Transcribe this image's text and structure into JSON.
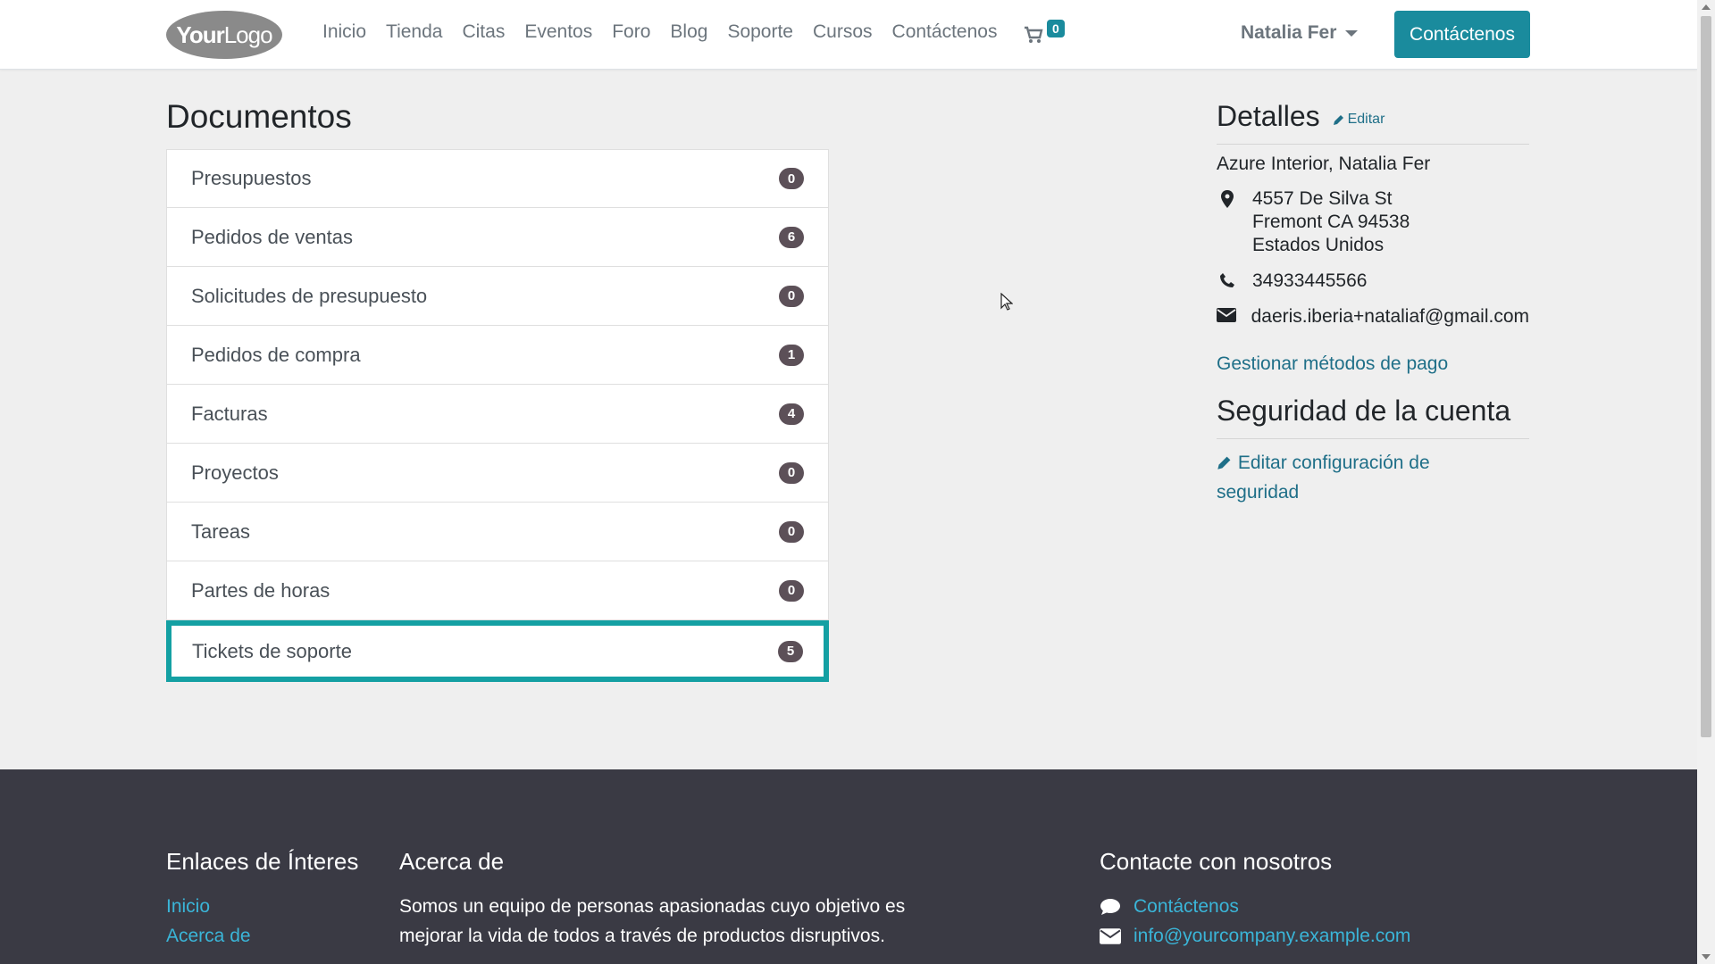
{
  "header": {
    "logo_bold": "Your",
    "logo_light": "Logo",
    "nav": [
      "Inicio",
      "Tienda",
      "Citas",
      "Eventos",
      "Foro",
      "Blog",
      "Soporte",
      "Cursos",
      "Contáctenos"
    ],
    "cart_count": "0",
    "user_name": "Natalia Fer",
    "contact_button": "Contáctenos"
  },
  "documents": {
    "title": "Documentos",
    "items": [
      {
        "label": "Presupuestos",
        "count": "0"
      },
      {
        "label": "Pedidos de ventas",
        "count": "6"
      },
      {
        "label": "Solicitudes de presupuesto",
        "count": "0"
      },
      {
        "label": "Pedidos de compra",
        "count": "1"
      },
      {
        "label": "Facturas",
        "count": "4"
      },
      {
        "label": "Proyectos",
        "count": "0"
      },
      {
        "label": "Tareas",
        "count": "0"
      },
      {
        "label": "Partes de horas",
        "count": "0"
      },
      {
        "label": "Tickets de soporte",
        "count": "5"
      }
    ]
  },
  "details": {
    "title": "Detalles",
    "edit_label": "Editar",
    "company": "Azure Interior, Natalia Fer",
    "address_line1": "4557 De Silva St",
    "address_line2": "Fremont CA 94538",
    "address_line3": "Estados Unidos",
    "phone": "34933445566",
    "email": "daeris.iberia+nataliaf@gmail.com",
    "payment_link": "Gestionar métodos de pago"
  },
  "security": {
    "title": "Seguridad de la cuenta",
    "edit_link": "Editar configuración de seguridad"
  },
  "footer": {
    "links_title": "Enlaces de Ínteres",
    "links": [
      "Inicio",
      "Acerca de"
    ],
    "about_title": "Acerca de",
    "about_text": "Somos un equipo de personas apasionadas cuyo objetivo es mejorar la vida de todos a través de productos disruptivos.",
    "contact_title": "Contacte con nosotros",
    "contact_link": "Contáctenos",
    "contact_email": "info@yourcompany.example.com"
  },
  "colors": {
    "accent": "#1a8b9d",
    "active_border": "#14a0a3",
    "badge": "#5c5058",
    "footer_bg": "#3a3a44",
    "footer_link": "#3ab5d8"
  }
}
